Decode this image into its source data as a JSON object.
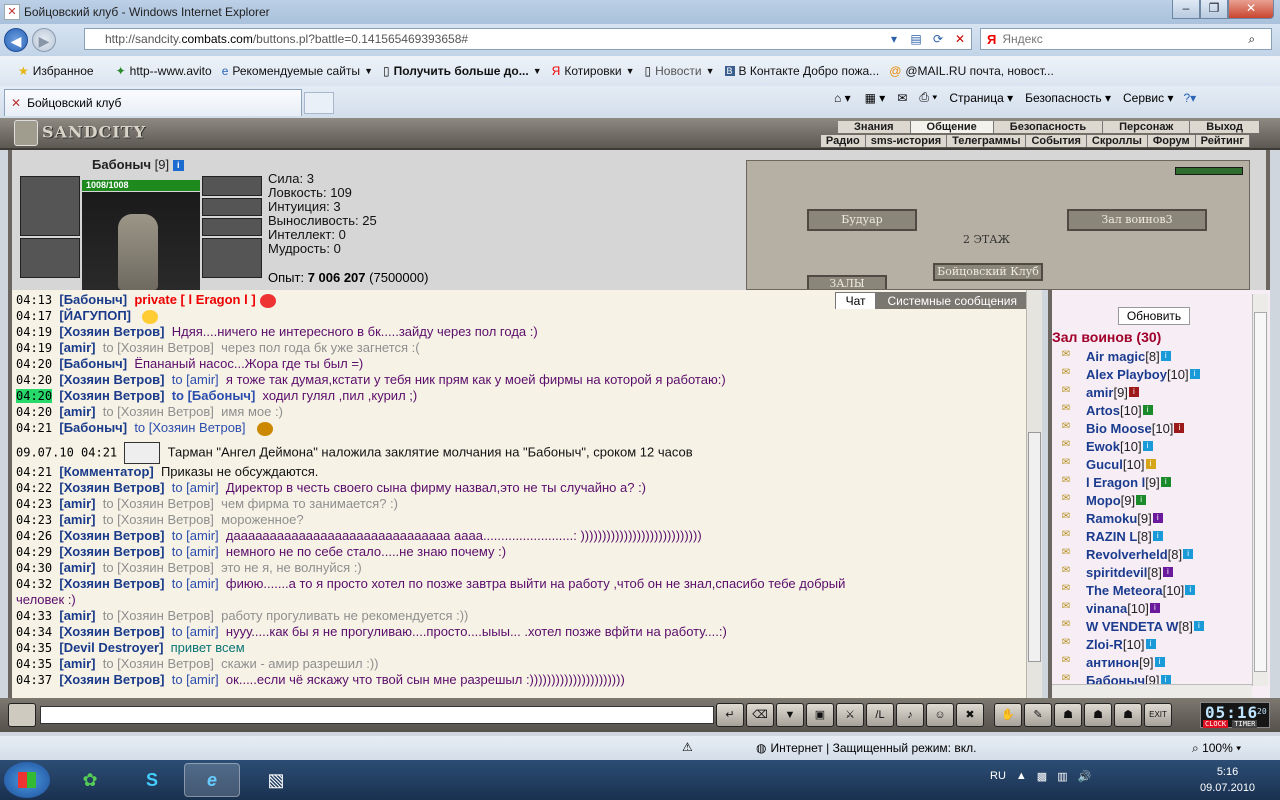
{
  "window": {
    "title": "Бойцовский клуб - Windows Internet Explorer"
  },
  "address": {
    "url_prefix": "http://sandcity.",
    "url_domain": "combats.com",
    "url_path": "/buttons.pl?battle=0.141565469393658#",
    "search_placeholder": "Яндекс",
    "search_logo": "Я"
  },
  "favorites": {
    "items": [
      {
        "label": "Избранное",
        "icon": "star-icon"
      },
      {
        "label": "http--www.avito",
        "icon": "web-icon"
      },
      {
        "label": "Рекомендуемые сайты",
        "icon": "ie-icon"
      },
      {
        "label": "Получить больше до...",
        "icon": "page-icon"
      },
      {
        "label": "Котировки",
        "icon": "yandex-icon"
      },
      {
        "label": "Новости",
        "icon": "page-icon"
      },
      {
        "label": "В Контакте  Добро пожа...",
        "icon": "vk-icon"
      },
      {
        "label": "@MAIL.RU почта, новост...",
        "icon": "mail-icon"
      }
    ]
  },
  "tabs": {
    "active": "Бойцовский клуб"
  },
  "commandbar": {
    "page": "Страница",
    "security": "Безопасность",
    "service": "Сервис"
  },
  "game": {
    "logo": "SANDCITY",
    "menu_top": [
      "Знания",
      "Общение",
      "Безопасность",
      "Персонаж",
      "Выход"
    ],
    "menu_active": "Общение",
    "menu_sub": [
      "Радио",
      "sms-история",
      "Телеграммы",
      "События",
      "Скроллы",
      "Форум",
      "Рейтинг"
    ]
  },
  "character": {
    "name": "Бабоныч",
    "level": "[9]",
    "hp": "1008/1008",
    "stats": [
      {
        "label": "Сила:",
        "value": "3"
      },
      {
        "label": "Ловкость:",
        "value": "109"
      },
      {
        "label": "Интуиция:",
        "value": "3"
      },
      {
        "label": "Выносливость:",
        "value": "25"
      },
      {
        "label": "Интеллект:",
        "value": "0"
      },
      {
        "label": "Мудрость:",
        "value": "0"
      }
    ],
    "exp_label": "Опыт:",
    "exp_value": "7 006 207",
    "exp_next": "(7500000)"
  },
  "map": {
    "left_room": "Будуар",
    "right_room": "Зал воинов3",
    "floor": "2 ЭТАЖ",
    "club": "Бойцовский Клуб",
    "halls": "ЗАЛЫ"
  },
  "chat": {
    "tab_chat": "Чат",
    "tab_system": "Системные сообщения",
    "messages": [
      {
        "time": "04:13",
        "nick": "[Бабоныч]",
        "to": "",
        "text": "private [ l Eragon l ]",
        "style": "red",
        "emo": true
      },
      {
        "time": "04:17",
        "nick": "[ЙАГУПОП]",
        "to": "",
        "text": "",
        "style": "",
        "emo": true
      },
      {
        "time": "04:19",
        "nick": "[Хозяин Ветров]",
        "to": "",
        "text": "Ндяя....ничего не интересного в бк.....зайду через пол года :)",
        "style": ""
      },
      {
        "time": "04:19",
        "nick": "[amir]",
        "to": "to [Хозяин Ветров]",
        "text": "через пол года бк уже загнется :(",
        "style": "gray"
      },
      {
        "time": "04:20",
        "nick": "[Бабоныч]",
        "to": "",
        "text": "Ёпананый насос...Жора где ты был =)",
        "style": ""
      },
      {
        "time": "04:20",
        "nick": "[Хозяин Ветров]",
        "to": "to [amir]",
        "text": "я тоже так думая,кстати у тебя ник прям как у моей фирмы на которой я работаю:)",
        "style": ""
      },
      {
        "time": "04:20",
        "nick": "[Хозяин Ветров]",
        "to": "to [Бабоныч]",
        "text": "ходил гулял ,пил ,курил ;)",
        "style": "",
        "hl": true,
        "tobold": true
      },
      {
        "time": "04:20",
        "nick": "[amir]",
        "to": "to [Хозяин Ветров]",
        "text": "имя мое :)",
        "style": "gray"
      },
      {
        "time": "04:21",
        "nick": "[Бабоныч]",
        "to": "to [Хозяин Ветров]",
        "text": "",
        "style": "",
        "emo": true
      },
      {
        "time": "09.07.10 04:21",
        "nick": "",
        "to": "",
        "text": "Тарман \"Ангел Деймона\" наложила заклятие молчания на \"Бабоныч\", сроком 12 часов",
        "style": "black",
        "sys": true
      },
      {
        "time": "04:21",
        "nick": "[Комментатор]",
        "to": "",
        "text": "Приказы не обсуждаются.",
        "style": "black"
      },
      {
        "time": "04:22",
        "nick": "[Хозяин Ветров]",
        "to": "to [amir]",
        "text": "Директор в честь своего сына фирму назвал,это не ты случайно а? :)",
        "style": ""
      },
      {
        "time": "04:23",
        "nick": "[amir]",
        "to": "to [Хозяин Ветров]",
        "text": "чем фирма то занимается? :)",
        "style": "gray"
      },
      {
        "time": "04:23",
        "nick": "[amir]",
        "to": "to [Хозяин Ветров]",
        "text": "мороженное?",
        "style": "gray"
      },
      {
        "time": "04:26",
        "nick": "[Хозяин Ветров]",
        "to": "to [amir]",
        "text": "даааааааааааааааааааааааааааааа аааа.........................: ))))))))))))))))))))))))))))",
        "style": ""
      },
      {
        "time": "04:29",
        "nick": "[Хозяин Ветров]",
        "to": "to [amir]",
        "text": "немного не по себе стало.....не знаю почему :)",
        "style": ""
      },
      {
        "time": "04:30",
        "nick": "[amir]",
        "to": "to [Хозяин Ветров]",
        "text": "это не я, не волнуйся :)",
        "style": "gray"
      },
      {
        "time": "04:32",
        "nick": "[Хозяин Ветров]",
        "to": "to [amir]",
        "text": "фиюю.......а то я просто хотел по позже завтра выйти на работу ,чтоб он не знал,спасибо тебе добрый",
        "style": ""
      },
      {
        "time": "",
        "nick": "",
        "to": "",
        "text": "человек :)",
        "style": ""
      },
      {
        "time": "04:33",
        "nick": "[amir]",
        "to": "to [Хозяин Ветров]",
        "text": "работу прогуливать не рекомендуется :))",
        "style": "gray"
      },
      {
        "time": "04:34",
        "nick": "[Хозяин Ветров]",
        "to": "to [amir]",
        "text": "нууу.....как бы я не прогуливаю....просто....ыыы... .хотел позже вфйти на работу....:)",
        "style": ""
      },
      {
        "time": "04:35",
        "nick": "[Devil Destroyer]",
        "to": "",
        "text": "привет всем",
        "style": "teal"
      },
      {
        "time": "04:35",
        "nick": "[amir]",
        "to": "to [Хозяин Ветров]",
        "text": "скажи - амир разрешил :))",
        "style": "gray"
      },
      {
        "time": "04:37",
        "nick": "[Хозяин Ветров]",
        "to": "to [amir]",
        "text": "ок.....если чё яскажу что твой сын мне разрешыл :))))))))))))))))))))))",
        "style": ""
      }
    ]
  },
  "online": {
    "refresh_label": "Обновить",
    "room": "Зал воинов (30)",
    "users": [
      {
        "name": "Air magic",
        "level": "[8]",
        "info_color": "#1a9ad6"
      },
      {
        "name": "Alex Playboy",
        "level": "[10]",
        "info_color": "#1a9ad6"
      },
      {
        "name": "amir",
        "level": "[9]",
        "info_color": "#9c1a1a"
      },
      {
        "name": "Artos",
        "level": "[10]",
        "info_color": "#1a8a2a"
      },
      {
        "name": "Bio Moose",
        "level": "[10]",
        "info_color": "#9c1a1a"
      },
      {
        "name": "Ewok",
        "level": "[10]",
        "info_color": "#1a9ad6"
      },
      {
        "name": "Gucul",
        "level": "[10]",
        "info_color": "#d6a61a"
      },
      {
        "name": "l Eragon l",
        "level": "[9]",
        "info_color": "#1a8a2a"
      },
      {
        "name": "Mopo",
        "level": "[9]",
        "info_color": "#1a8a2a"
      },
      {
        "name": "Ramoku",
        "level": "[9]",
        "info_color": "#6b1a9c"
      },
      {
        "name": "RAZIN L",
        "level": "[8]",
        "info_color": "#1a9ad6"
      },
      {
        "name": "Revolverheld",
        "level": "[8]",
        "info_color": "#1a9ad6"
      },
      {
        "name": "spiritdevil",
        "level": "[8]",
        "info_color": "#6b1a9c"
      },
      {
        "name": "The Meteora",
        "level": "[10]",
        "info_color": "#1a9ad6"
      },
      {
        "name": "vinana",
        "level": "[10]",
        "info_color": "#6b1a9c"
      },
      {
        "name": "W VENDETA W",
        "level": "[8]",
        "info_color": "#1a9ad6"
      },
      {
        "name": "Zloi-R",
        "level": "[10]",
        "info_color": "#1a9ad6"
      },
      {
        "name": "антинон",
        "level": "[9]",
        "info_color": "#1a9ad6"
      },
      {
        "name": "Бабоныч",
        "level": "[9]",
        "info_color": "#1a9ad6"
      }
    ]
  },
  "toolbar": {
    "clock_time": "05:16",
    "clock_sec": "20",
    "clock_label": "CLOCK",
    "timer_label": "TIMER",
    "exit_label": "EXIT"
  },
  "statusbar": {
    "zone": "Интернет | Защищенный режим: вкл.",
    "zoom": "100%"
  },
  "taskbar": {
    "lang": "RU",
    "time": "5:16",
    "date": "09.07.2010"
  }
}
